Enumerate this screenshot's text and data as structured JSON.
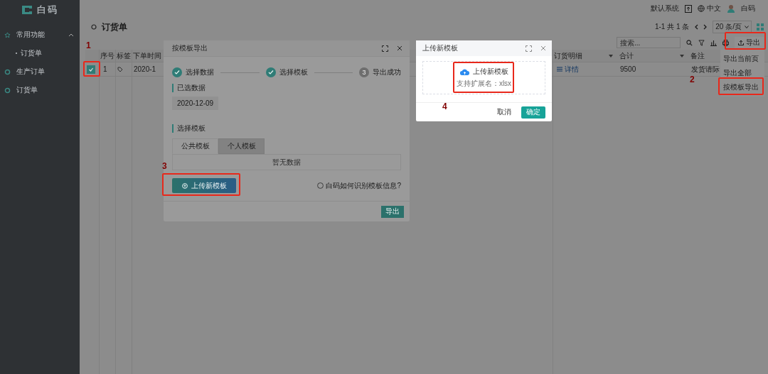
{
  "sidebar": {
    "logo": "白码",
    "groups": [
      {
        "label": "常用功能",
        "expanded": true,
        "children": [
          {
            "label": "订货单"
          }
        ]
      },
      {
        "label": "生产订单"
      },
      {
        "label": "订货单"
      }
    ]
  },
  "topbar": {
    "system": "默认系统",
    "language": "中文",
    "user": "白码"
  },
  "page": {
    "title": "订货单",
    "pager": {
      "range": "1-1 共 1 条",
      "page_size": "20 条/页"
    },
    "search": {
      "placeholder": "搜索..."
    },
    "export_button": "导出",
    "export_menu": [
      {
        "label": "导出当前页"
      },
      {
        "label": "导出全部"
      },
      {
        "label": "按模板导出"
      }
    ]
  },
  "table": {
    "columns": [
      "序号",
      "标签",
      "下单时间",
      "订货明细",
      "合计",
      "备注"
    ],
    "rows": [
      {
        "checked": true,
        "index": "1",
        "time": "2020-1",
        "detail": "详情",
        "total": "9500",
        "note": "发货请际"
      }
    ]
  },
  "export_dialog": {
    "title": "按模板导出",
    "steps": [
      {
        "label": "选择数据",
        "done": true
      },
      {
        "label": "选择模板",
        "done": true
      },
      {
        "number": "3",
        "label": "导出成功",
        "done": false
      }
    ],
    "selected_heading": "已选数据",
    "selected_data": [
      "2020-12-09"
    ],
    "template_heading": "选择模板",
    "template_tabs": [
      {
        "label": "公共模板",
        "selected": true
      },
      {
        "label": "个人模板",
        "selected": false
      }
    ],
    "empty_text": "暂无数据",
    "upload_button": "上传新模板",
    "help": "白码如何识别模板信息?",
    "export_button": "导出"
  },
  "upload_dialog": {
    "title": "上传新模板",
    "upload_label": "上传新模板",
    "hint": "支持扩展名：xlsx",
    "cancel": "取消",
    "ok": "确定"
  },
  "annotations": [
    {
      "label": "1"
    },
    {
      "label": "2"
    },
    {
      "label": "3"
    },
    {
      "label": "4"
    }
  ]
}
